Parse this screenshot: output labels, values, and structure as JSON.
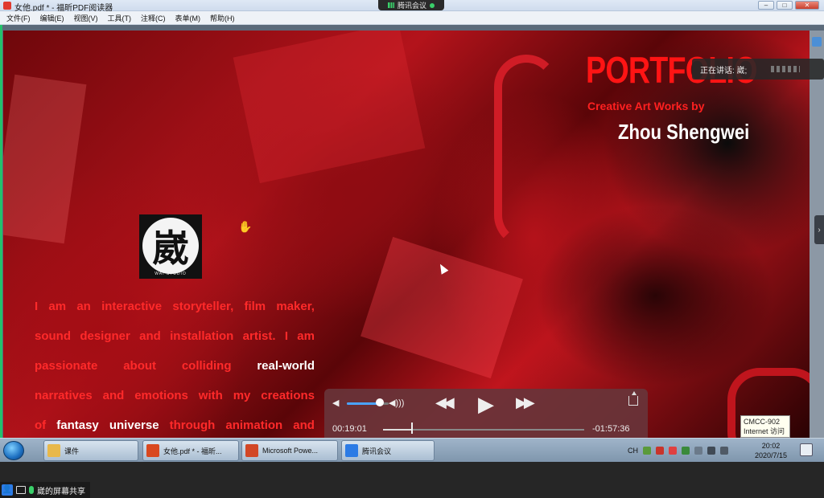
{
  "window": {
    "title": "女他.pdf * - 福昕PDF阅读器",
    "meeting_tab": "腾讯会议"
  },
  "menu": [
    "文件(F)",
    "编辑(E)",
    "视图(V)",
    "工具(T)",
    "注释(C)",
    "表单(M)",
    "帮助(H)"
  ],
  "document": {
    "title": "PORTFOLIO",
    "subtitle": "Creative Art Works by",
    "author": "Zhou Shengwei",
    "logo_glyph": "崴",
    "logo_text": "WAI STUDIO",
    "bio_lines": [
      [
        "I",
        "am",
        "an",
        "interactive",
        "storyteller,",
        "film",
        "maker,"
      ],
      [
        "sound",
        "designer",
        "and",
        "installation",
        "artist.",
        "I",
        "am"
      ],
      [
        "passionate",
        "about",
        "colliding",
        "real-world"
      ],
      [
        "narratives",
        "and",
        "emotions",
        "with",
        "my",
        "creations"
      ],
      [
        "of",
        "fantasy",
        "universe",
        "through",
        "animation",
        "and"
      ]
    ]
  },
  "speaking": {
    "label": "正在讲话: 崴;"
  },
  "player": {
    "elapsed": "00:19:01",
    "remaining": "-01:57:36",
    "volume": 0.8,
    "progress": 0.14,
    "icons": [
      "volume-low-icon",
      "volume-high-icon",
      "rewind-icon",
      "play-icon",
      "fast-forward-icon",
      "share-icon"
    ]
  },
  "tooltip": {
    "line1": "CMCC-902",
    "line2": "Internet 访问"
  },
  "taskbar": {
    "items": [
      {
        "label": "课件",
        "color": "#e8b84a"
      },
      {
        "label": "女他.pdf * - 福昕...",
        "color": "#d9481f"
      },
      {
        "label": "Microsoft Powe...",
        "color": "#d24726"
      },
      {
        "label": "腾讯会议",
        "color": "#2c7be5"
      }
    ],
    "tray_lang": "CH",
    "time": "20:02",
    "date": "2020/7/15"
  },
  "sharebar": {
    "label": "崴的屏幕共享"
  },
  "colors": {
    "accent_red": "#ff1414",
    "meeting_green": "#23c26b"
  }
}
